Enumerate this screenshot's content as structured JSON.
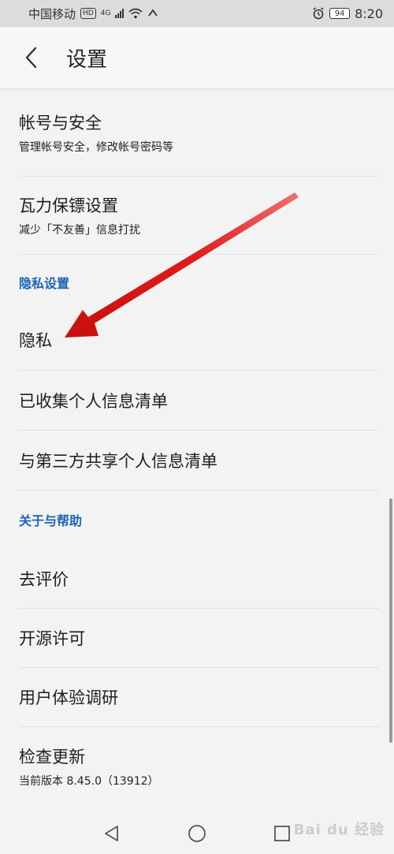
{
  "status_bar": {
    "carrier": "中国移动",
    "hd": "HD",
    "network": "4G",
    "battery": "94",
    "time": "8:20"
  },
  "header": {
    "title": "设置"
  },
  "items": {
    "account": {
      "title": "帐号与安全",
      "subtitle": "管理帐号安全，修改帐号密码等"
    },
    "bodyguard": {
      "title": "瓦力保镖设置",
      "subtitle": "减少「不友善」信息打扰"
    },
    "privacy_section": "隐私设置",
    "privacy": {
      "title": "隐私"
    },
    "collected": {
      "title": "已收集个人信息清单"
    },
    "shared": {
      "title": "与第三方共享个人信息清单"
    },
    "about_section": "关于与帮助",
    "rate": {
      "title": "去评价"
    },
    "license": {
      "title": "开源许可"
    },
    "research": {
      "title": "用户体验调研"
    },
    "update": {
      "title": "检查更新",
      "subtitle": "当前版本 8.45.0（13912）"
    }
  },
  "watermark": "Bai du 经验",
  "colors": {
    "section_header": "#1a64b5",
    "annotation_arrow": "#e01b1b"
  }
}
